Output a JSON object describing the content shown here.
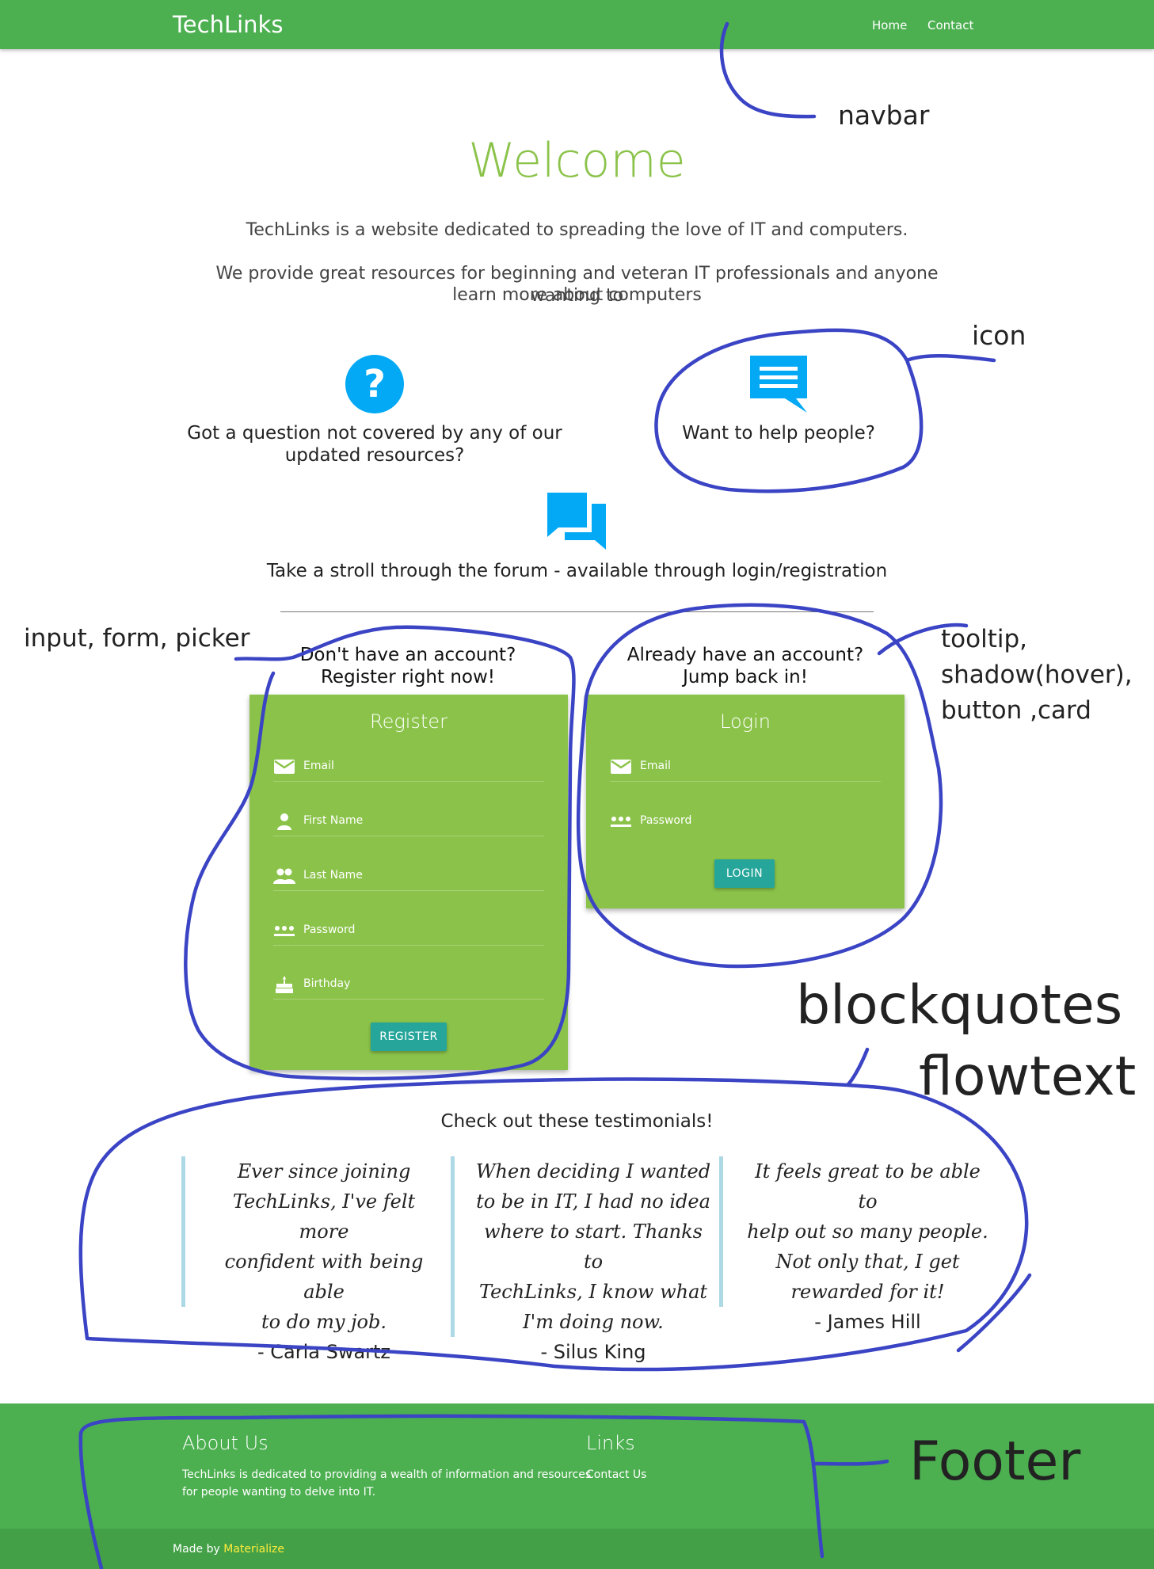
{
  "navbar": {
    "brand": "TechLinks",
    "links": [
      "Home",
      "Contact"
    ],
    "color": "#4caf50"
  },
  "hero": {
    "title": "Welcome",
    "paragraph1": "TechLinks is a website dedicated to spreading the love of IT and computers.",
    "paragraph2_line1": "We provide great resources for beginning and veteran IT professionals and anyone wanting to",
    "paragraph2_line2": "learn more about computers"
  },
  "features": {
    "question": {
      "icon": "help-circle-icon",
      "line1": "Got a question not covered by any of our",
      "line2": "updated resources?"
    },
    "help": {
      "icon": "chat-bubble-icon",
      "text": "Want to help people?"
    },
    "forum": {
      "icon": "forum-icon",
      "text": "Take a stroll through the forum - available through login/registration"
    }
  },
  "register": {
    "caption_line1": "Don't have an account?",
    "caption_line2": "Register right now!",
    "title": "Register",
    "fields": [
      {
        "icon": "email-icon",
        "label": "Email"
      },
      {
        "icon": "person-icon",
        "label": "First Name"
      },
      {
        "icon": "people-icon",
        "label": "Last Name"
      },
      {
        "icon": "password-icon",
        "label": "Password"
      },
      {
        "icon": "cake-icon",
        "label": "Birthday"
      }
    ],
    "button": "REGISTER"
  },
  "login": {
    "caption_line1": "Already have an account?",
    "caption_line2": "Jump back in!",
    "title": "Login",
    "fields": [
      {
        "icon": "email-icon",
        "label": "Email"
      },
      {
        "icon": "password-icon",
        "label": "Password"
      }
    ],
    "button": "LOGIN"
  },
  "testimonials": {
    "heading": "Check out these testimonials!",
    "items": [
      {
        "lines": [
          "Ever since joining",
          "TechLinks, I've felt more",
          "confident with being able",
          "to do my job."
        ],
        "author": "- Carla Swartz"
      },
      {
        "lines": [
          "When deciding I wanted",
          "to be in IT, I had no idea",
          "where to start. Thanks to",
          "TechLinks, I know what",
          "I'm doing now."
        ],
        "author": "- Silus King"
      },
      {
        "lines": [
          "It feels great to be able to",
          "help out so many people.",
          "Not only that, I get",
          "rewarded for it!"
        ],
        "author": "- James Hill"
      }
    ]
  },
  "footer": {
    "about_heading": "About Us",
    "about_line1": "TechLinks is dedicated to providing a wealth of information and resources",
    "about_line2": "for people wanting to delve into IT.",
    "links_heading": "Links",
    "link_contact": "Contact Us",
    "made_by_prefix": "Made by",
    "made_by_link": "Materialize"
  },
  "annotations": {
    "navbar": "navbar",
    "icon": "icon",
    "form": "input, form, picker",
    "tooltip_line1": "tooltip,",
    "tooltip_line2": "shadow(hover),",
    "tooltip_line3": "button ,card",
    "blockquotes": "blockquotes",
    "flowtext": "flowtext",
    "footer": "Footer"
  },
  "colors": {
    "accent_green": "#8bc34a",
    "nav_green": "#4caf50",
    "icon_blue": "#03a9f4",
    "button_teal": "#26a69a",
    "quote_border": "#add8e6",
    "annotation_ink": "#3a44c4"
  }
}
